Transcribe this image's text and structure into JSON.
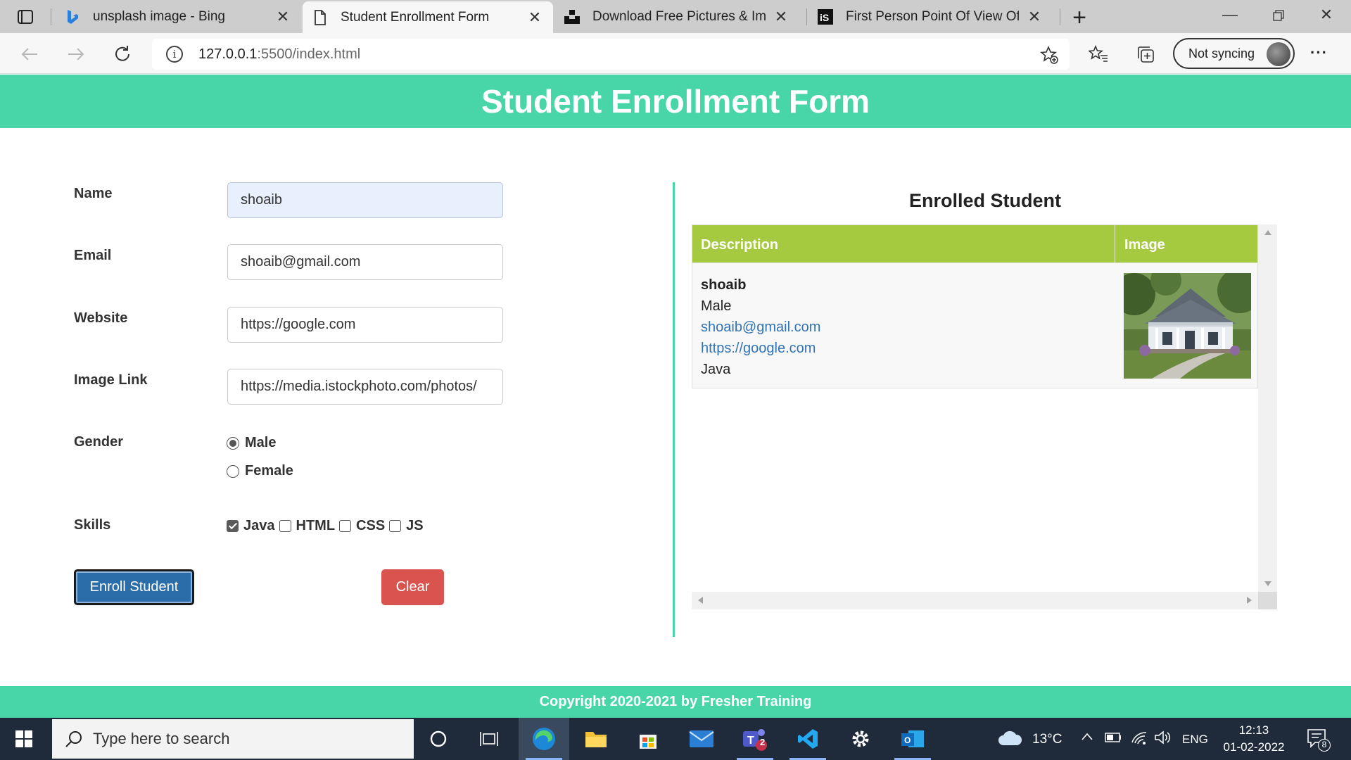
{
  "browser": {
    "tabs": [
      {
        "title": "unsplash image - Bing",
        "icon": "bing-icon"
      },
      {
        "title": "Student Enrollment Form",
        "icon": "document-icon",
        "active": true
      },
      {
        "title": "Download Free Pictures & Images",
        "icon": "unsplash-icon"
      },
      {
        "title": "First Person Point Of View Of A W",
        "icon": "istock-icon"
      }
    ],
    "url_host": "127.0.0.1",
    "url_rest": ":5500/index.html",
    "sync_label": "Not syncing"
  },
  "page": {
    "header_title": "Student Enrollment Form",
    "footer_text": "Copyright 2020-2021 by Fresher Training"
  },
  "form": {
    "name_label": "Name",
    "name_value": "shoaib",
    "email_label": "Email",
    "email_value": "shoaib@gmail.com",
    "website_label": "Website",
    "website_value": "https://google.com",
    "image_label": "Image Link",
    "image_value": "https://media.istockphoto.com/photos/",
    "gender_label": "Gender",
    "gender_options": [
      "Male",
      "Female"
    ],
    "gender_selected": "Male",
    "skills_label": "Skills",
    "skills": [
      {
        "label": "Java",
        "checked": true
      },
      {
        "label": "HTML",
        "checked": false
      },
      {
        "label": "CSS",
        "checked": false
      },
      {
        "label": "JS",
        "checked": false
      }
    ],
    "enroll_label": "Enroll Student",
    "clear_label": "Clear"
  },
  "enrolled": {
    "title": "Enrolled Student",
    "col_description": "Description",
    "col_image": "Image",
    "rows": [
      {
        "name": "shoaib",
        "gender": "Male",
        "email": "shoaib@gmail.com",
        "website": "https://google.com",
        "skills": "Java"
      }
    ]
  },
  "taskbar": {
    "search_placeholder": "Type here to search",
    "temperature": "13°C",
    "language": "ENG",
    "time": "12:13",
    "date": "01-02-2022",
    "notification_count": "8",
    "teams_badge": "2"
  },
  "colors": {
    "accent": "#48d6a9",
    "table_header": "#a5c93f",
    "enroll_button": "#2b6da8",
    "clear_button": "#d9534f",
    "link": "#3273b4"
  }
}
